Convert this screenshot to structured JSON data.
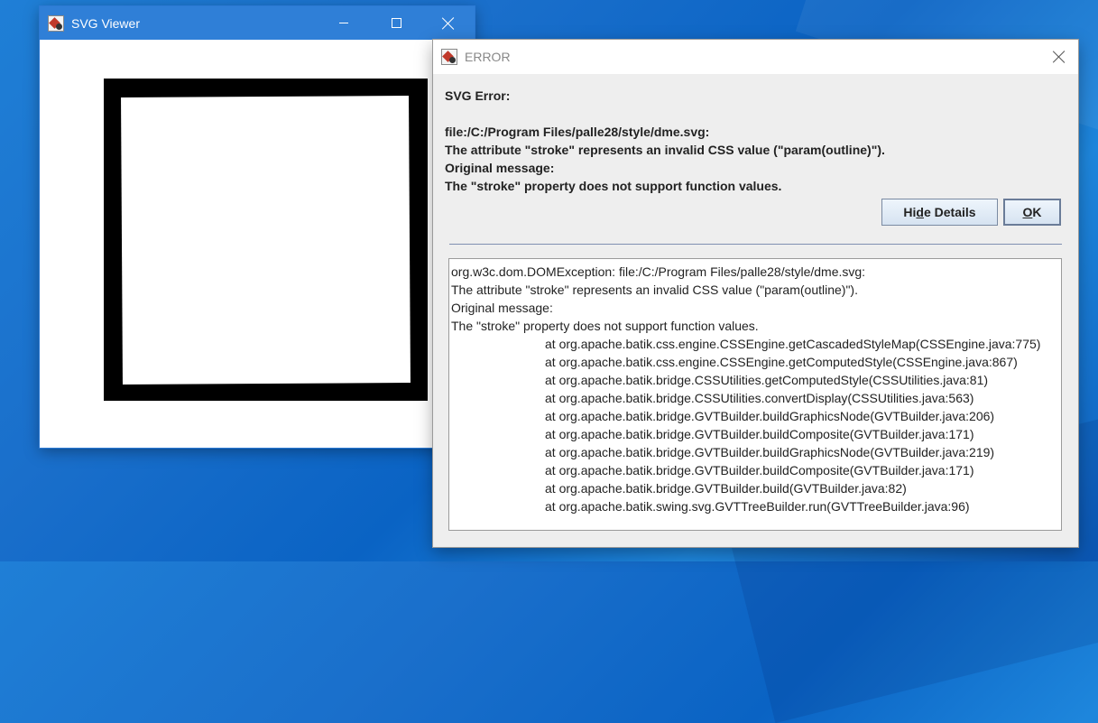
{
  "viewer": {
    "title": "SVG Viewer",
    "icons": {
      "app": "java-app-icon",
      "minimize": "minimize-icon",
      "maximize": "maximize-icon",
      "close": "close-icon"
    }
  },
  "dialog": {
    "title": "ERROR",
    "heading": "SVG Error:",
    "message_lines": [
      "file:/C:/Program Files/palle28/style/dme.svg:",
      "The attribute \"stroke\" represents an invalid CSS value (\"param(outline)\").",
      "Original message:",
      "The \"stroke\" property does not support function values."
    ],
    "buttons": {
      "hide_details": {
        "before": "Hi",
        "mnemonic": "d",
        "after": "e Details"
      },
      "ok": {
        "mnemonic": "O",
        "after": "K"
      }
    },
    "details": {
      "lines": [
        "org.w3c.dom.DOMException: file:/C:/Program Files/palle28/style/dme.svg:",
        "The attribute \"stroke\" represents an invalid CSS value (\"param(outline)\").",
        "Original message:",
        "The \"stroke\" property does not support function values."
      ],
      "stack": [
        "at org.apache.batik.css.engine.CSSEngine.getCascadedStyleMap(CSSEngine.java:775)",
        "at org.apache.batik.css.engine.CSSEngine.getComputedStyle(CSSEngine.java:867)",
        "at org.apache.batik.bridge.CSSUtilities.getComputedStyle(CSSUtilities.java:81)",
        "at org.apache.batik.bridge.CSSUtilities.convertDisplay(CSSUtilities.java:563)",
        "at org.apache.batik.bridge.GVTBuilder.buildGraphicsNode(GVTBuilder.java:206)",
        "at org.apache.batik.bridge.GVTBuilder.buildComposite(GVTBuilder.java:171)",
        "at org.apache.batik.bridge.GVTBuilder.buildGraphicsNode(GVTBuilder.java:219)",
        "at org.apache.batik.bridge.GVTBuilder.buildComposite(GVTBuilder.java:171)",
        "at org.apache.batik.bridge.GVTBuilder.build(GVTBuilder.java:82)",
        "at org.apache.batik.swing.svg.GVTTreeBuilder.run(GVTTreeBuilder.java:96)"
      ]
    }
  },
  "colors": {
    "titlebar": "#2f7fd7",
    "desktop": "#1a6fcb",
    "dialog_bg": "#eeeeee"
  }
}
